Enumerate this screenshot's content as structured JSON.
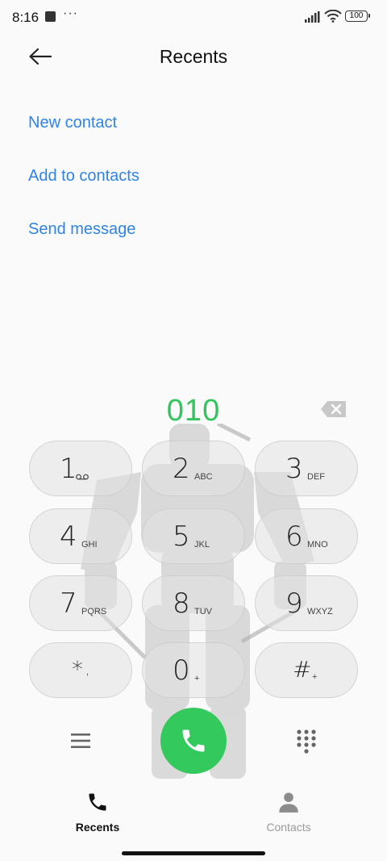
{
  "status": {
    "time": "8:16",
    "dots": "···",
    "battery": "100"
  },
  "header": {
    "title": "Recents"
  },
  "actions": [
    "New contact",
    "Add to contacts",
    "Send message"
  ],
  "dialer": {
    "number": "010",
    "keys": [
      {
        "digit": "1",
        "letters": ""
      },
      {
        "digit": "2",
        "letters": "ABC"
      },
      {
        "digit": "3",
        "letters": "DEF"
      },
      {
        "digit": "4",
        "letters": "GHI"
      },
      {
        "digit": "5",
        "letters": "JKL"
      },
      {
        "digit": "6",
        "letters": "MNO"
      },
      {
        "digit": "7",
        "letters": "PQRS"
      },
      {
        "digit": "8",
        "letters": "TUV"
      },
      {
        "digit": "9",
        "letters": "WXYZ"
      },
      {
        "digit": "*",
        "letters": ","
      },
      {
        "digit": "0",
        "letters": "+"
      },
      {
        "digit": "#",
        "letters": "+"
      }
    ]
  },
  "tabs": [
    {
      "label": "Recents",
      "active": true
    },
    {
      "label": "Contacts",
      "active": false
    }
  ],
  "colors": {
    "accent_blue": "#2f84e6",
    "dial_green": "#34c95d",
    "number_green": "#34c45d"
  }
}
